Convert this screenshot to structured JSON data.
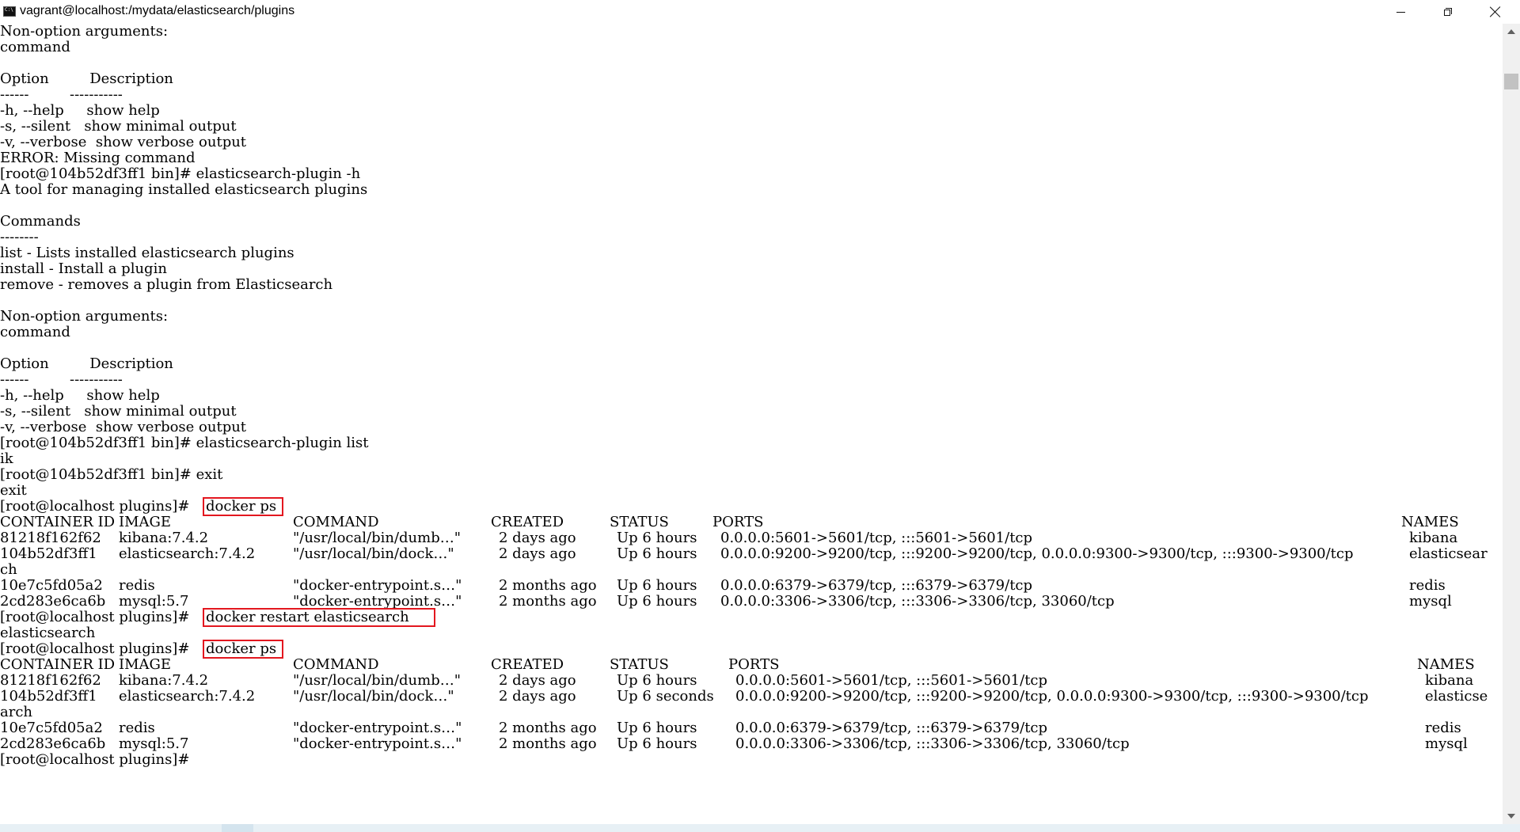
{
  "window": {
    "title": "vagrant@localhost:/mydata/elasticsearch/plugins",
    "icon": "cmd-icon",
    "controls": {
      "minimize": "minimize-icon",
      "maximize": "restore-icon",
      "close": "close-icon"
    }
  },
  "highlight_color": "#e3171f",
  "console": {
    "lines": [
      "Non-option arguments:",
      "command",
      "",
      "Option         Description",
      "------         -----------",
      "-h, --help     show help",
      "-s, --silent   show minimal output",
      "-v, --verbose  show verbose output",
      "ERROR: Missing command",
      "[root@104b52df3ff1 bin]# elasticsearch-plugin -h",
      "A tool for managing installed elasticsearch plugins",
      "",
      "Commands",
      "--------",
      "list - Lists installed elasticsearch plugins",
      "install - Install a plugin",
      "remove - removes a plugin from Elasticsearch",
      "",
      "Non-option arguments:",
      "command",
      "",
      "Option         Description",
      "------         -----------",
      "-h, --help     show help",
      "-s, --silent   show minimal output",
      "-v, --verbose  show verbose output",
      "[root@104b52df3ff1 bin]# elasticsearch-plugin list",
      "ik",
      "[root@104b52df3ff1 bin]# exit",
      "exit"
    ],
    "prompt": "[root@localhost plugins]# ",
    "cmd_ps": "docker ps",
    "cmd_restart": "docker restart elasticsearch",
    "restart_output": "elasticsearch",
    "table1": {
      "headers": [
        "CONTAINER ID",
        "IMAGE",
        "COMMAND",
        "CREATED",
        "STATUS",
        "PORTS",
        "NAMES"
      ],
      "rows": [
        [
          "81218f162f62",
          "kibana:7.4.2",
          "\"/usr/local/bin/dumb…\"",
          "2 days ago",
          "Up 6 hours",
          "0.0.0.0:5601->5601/tcp, :::5601->5601/tcp",
          "kibana"
        ],
        [
          "104b52df3ff1",
          "elasticsearch:7.4.2",
          "\"/usr/local/bin/dock…\"",
          "2 days ago",
          "Up 6 hours",
          "0.0.0.0:9200->9200/tcp, :::9200->9200/tcp, 0.0.0.0:9300->9300/tcp, :::9300->9300/tcp",
          "elasticsear"
        ],
        [
          "10e7c5fd05a2",
          "redis",
          "\"docker-entrypoint.s…\"",
          "2 months ago",
          "Up 6 hours",
          "0.0.0.0:6379->6379/tcp, :::6379->6379/tcp",
          "redis"
        ],
        [
          "2cd283e6ca6b",
          "mysql:5.7",
          "\"docker-entrypoint.s…\"",
          "2 months ago",
          "Up 6 hours",
          "0.0.0.0:3306->3306/tcp, :::3306->3306/tcp, 33060/tcp",
          "mysql"
        ]
      ],
      "wrap": "ch"
    },
    "table2": {
      "headers": [
        "CONTAINER ID",
        "IMAGE",
        "COMMAND",
        "CREATED",
        "STATUS",
        "PORTS",
        "NAMES"
      ],
      "rows": [
        [
          "81218f162f62",
          "kibana:7.4.2",
          "\"/usr/local/bin/dumb…\"",
          "2 days ago",
          "Up 6 hours",
          "0.0.0.0:5601->5601/tcp, :::5601->5601/tcp",
          "kibana"
        ],
        [
          "104b52df3ff1",
          "elasticsearch:7.4.2",
          "\"/usr/local/bin/dock…\"",
          "2 days ago",
          "Up 6 seconds",
          "0.0.0.0:9200->9200/tcp, :::9200->9200/tcp, 0.0.0.0:9300->9300/tcp, :::9300->9300/tcp",
          "elasticse"
        ],
        [
          "10e7c5fd05a2",
          "redis",
          "\"docker-entrypoint.s…\"",
          "2 months ago",
          "Up 6 hours",
          "0.0.0.0:6379->6379/tcp, :::6379->6379/tcp",
          "redis"
        ],
        [
          "2cd283e6ca6b",
          "mysql:5.7",
          "\"docker-entrypoint.s…\"",
          "2 months ago",
          "Up 6 hours",
          "0.0.0.0:3306->3306/tcp, :::3306->3306/tcp, 33060/tcp",
          "mysql"
        ]
      ],
      "wrap": "arch"
    }
  }
}
